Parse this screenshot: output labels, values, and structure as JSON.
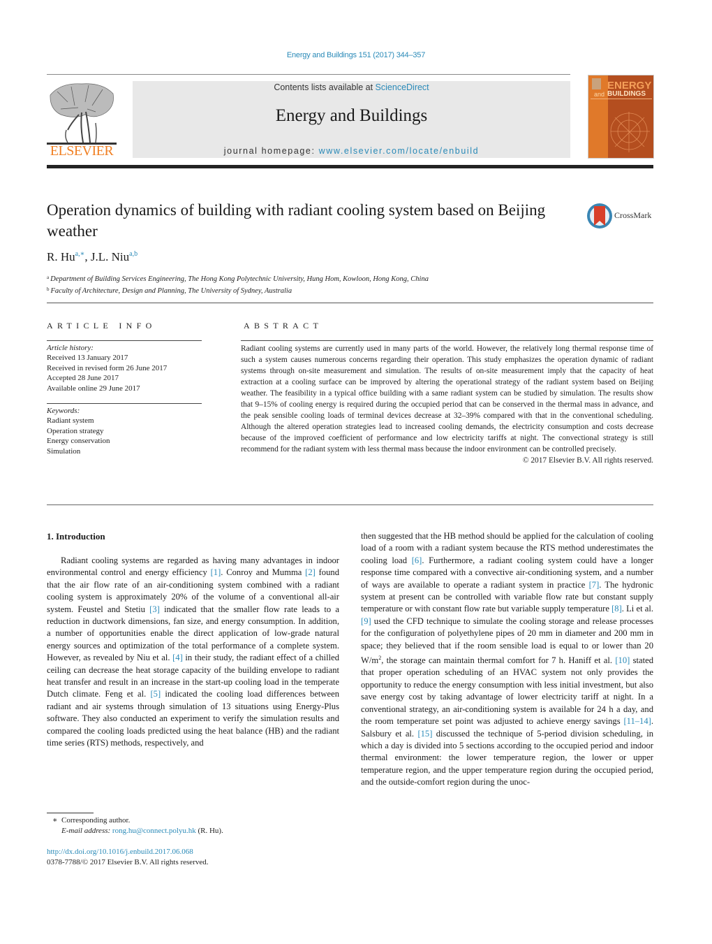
{
  "header": {
    "journal_citation": "Energy and Buildings 151 (2017) 344–357",
    "contents_prefix": "Contents lists available at ",
    "contents_link": "ScienceDirect",
    "journal_title": "Energy and Buildings",
    "homepage_prefix": "journal homepage: ",
    "homepage_link": "www.elsevier.com/locate/enbuild",
    "publisher_logo_text": "ELSEVIER",
    "cover": {
      "energy": "ENERGY",
      "and": "and",
      "buildings": "BUILDINGS"
    },
    "colors": {
      "link": "#2a8ab8",
      "elsevier_orange": "#f07f22",
      "cover_brown": "#b44e1f"
    }
  },
  "article": {
    "title": "Operation dynamics of building with radiant cooling system based on Beijing weather",
    "crossmark_label": "CrossMark",
    "authors": [
      {
        "name": "R. Hu",
        "marks": "a,∗"
      },
      {
        "name": "J.L. Niu",
        "marks": "a,b"
      }
    ],
    "author_separator": ", ",
    "affiliations": [
      {
        "mark": "a",
        "text": "Department of Building Services Engineering, The Hong Kong Polytechnic University, Hung Hom, Kowloon, Hong Kong, China"
      },
      {
        "mark": "b",
        "text": "Faculty of Architecture, Design and Planning, The University of Sydney, Australia"
      }
    ]
  },
  "article_info": {
    "heading": "ARTICLE INFO",
    "history_label": "Article history:",
    "history": [
      "Received 13 January 2017",
      "Received in revised form 26 June 2017",
      "Accepted 28 June 2017",
      "Available online 29 June 2017"
    ],
    "keywords_label": "Keywords:",
    "keywords": [
      "Radiant system",
      "Operation strategy",
      "Energy conservation",
      "Simulation"
    ]
  },
  "abstract": {
    "heading": "ABSTRACT",
    "text": "Radiant cooling systems are currently used in many parts of the world. However, the relatively long thermal response time of such a system causes numerous concerns regarding their operation. This study emphasizes the operation dynamic of radiant systems through on-site measurement and simulation. The results of on-site measurement imply that the capacity of heat extraction at a cooling surface can be improved by altering the operational strategy of the radiant system based on Beijing weather. The feasibility in a typical office building with a same radiant system can be studied by simulation. The results show that 9–15% of cooling energy is required during the occupied period that can be conserved in the thermal mass in advance, and the peak sensible cooling loads of terminal devices decrease at 32–39% compared with that in the conventional scheduling. Although the altered operation strategies lead to increased cooling demands, the electricity consumption and costs decrease because of the improved coefficient of performance and low electricity tariffs at night. The convectional strategy is still recommend for the radiant system with less thermal mass because the indoor environment can be controlled precisely.",
    "copyright": "© 2017 Elsevier B.V. All rights reserved."
  },
  "body": {
    "section_heading": "1.  Introduction",
    "left_column": [
      {
        "t": "Radiant cooling systems are regarded as having many advan­tages in indoor environmental control and energy efficiency "
      },
      {
        "ref": "[1]"
      },
      {
        "t": ". Conroy and Mumma "
      },
      {
        "ref": "[2]"
      },
      {
        "t": " found that the air flow rate of an air-conditioning system combined with a radiant cooling system is approximately 20% of the volume of a conventional all-air system. Feustel and Stetiu "
      },
      {
        "ref": "[3]"
      },
      {
        "t": " indicated that the smaller flow rate leads to a reduction in ductwork dimensions, fan size, and energy con­sumption. In addition, a number of opportunities enable the direct application of low-grade natural energy sources and optimiza­tion of the total performance of a complete system. However, as revealed by Niu et al. "
      },
      {
        "ref": "[4]"
      },
      {
        "t": " in their study, the radiant effect of a chilled ceiling can decrease the heat storage capacity of the building enve­lope to radiant heat transfer and result in an increase in the start-up cooling load in the temperate Dutch climate. Feng et al. "
      },
      {
        "ref": "[5]"
      },
      {
        "t": " indi­cated the cooling load differences between radiant and air systems through simulation of 13 situations using Energy-Plus software. They also conducted an experiment to verify the simulation results and compared the cooling loads predicted using the heat balance (HB) and the radiant time series (RTS) methods, respectively, and"
      }
    ],
    "right_column": [
      {
        "t": "then suggested that the HB method should be applied for the cal­culation of cooling load of a room with a radiant system because the RTS method underestimates the cooling load "
      },
      {
        "ref": "[6]"
      },
      {
        "t": ". Furthermore, a radiant cooling system could have a longer response time com­pared with a convective air-conditioning system, and a number of ways are available to operate a radiant system in practice "
      },
      {
        "ref": "[7]"
      },
      {
        "t": ". The hydronic system at present can be controlled with variable flow rate but constant supply temperature or with constant flow rate but variable supply temperature "
      },
      {
        "ref": "[8]"
      },
      {
        "t": ". Li et al. "
      },
      {
        "ref": "[9]"
      },
      {
        "t": " used the CFD technique to simulate the cooling storage and release processes for the con­figuration of polyethylene pipes of 20 mm in diameter and 200 mm in space; they believed that if the room sensible load is equal to or lower than 20 W/m"
      },
      {
        "sup": "2"
      },
      {
        "t": ", the storage can maintain thermal comfort for 7 h. Haniff et al. "
      },
      {
        "ref": "[10]"
      },
      {
        "t": " stated that proper operation scheduling of an HVAC system not only provides the opportunity to reduce the energy consumption with less initial investment, but also save energy cost by taking advantage of lower electricity tariff at night. In a conventional strategy, an air-conditioning system is available for 24 h a day, and the room temperature set point was adjusted to achieve energy savings "
      },
      {
        "ref": "[11–14]"
      },
      {
        "t": ". Salsbury et al. "
      },
      {
        "ref": "[15]"
      },
      {
        "t": " discussed the technique of 5-period division scheduling, in which a day is divided into 5 sections according to the occupied period and indoor thermal environment: the lower temperature region, the lower or upper temperature region, and the upper temperature region during the occupied period, and the outside-comfort region during the unoc-"
      }
    ]
  },
  "footnotes": {
    "star": "∗",
    "corresponding": "Corresponding author.",
    "email_label": "E-mail address:",
    "email": "rong.hu@connect.polyu.hk",
    "email_suffix": " (R. Hu).",
    "doi": "http://dx.doi.org/10.1016/j.enbuild.2017.06.068",
    "issn_line": "0378-7788/© 2017 Elsevier B.V. All rights reserved."
  }
}
